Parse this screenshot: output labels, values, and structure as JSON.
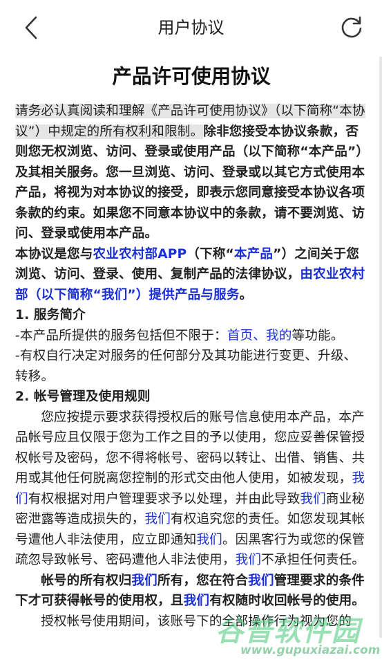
{
  "header": {
    "title": "用户协议"
  },
  "document": {
    "title": "产品许可使用协议",
    "p1": {
      "hl1": "请务必认真阅读和理解《产品许可使用协议》（以下简称",
      "hl2": "“本协议”）中规定的所有权利和限制。",
      "bold": "除非您接受本协议条款，否则您无权浏览、访问、登录或使用产品（以下简称“本产品”）及其相关服务。您一旦浏览、访问、登录或以其它方式使用本产品，将视为对本协议的接受，即表示您同意接受本协议各项条款的约束。如果您不同意本协议中的条款，请不要浏览、访问、登录或使用本产品。"
    },
    "p2": {
      "t1": "本协议是您与",
      "link1": "农业农村部APP",
      "t2": "（下称“",
      "link2": "本产品",
      "t3": "”）之间关于您浏览、访问、登录、使用、复制产品的法律协议，",
      "link3": "由农业农村部（以下简称“我们”）提供产品与服务",
      "t4": "。"
    },
    "s1": {
      "heading": "1. 服务简介",
      "l1_a": "-本产品所提供的服务包括但不限于：",
      "l1_link": "首页、我的",
      "l1_b": "等功能。",
      "l2": "-有权自行决定对服务的任何部分及其功能进行变更、升级、转移。"
    },
    "s2": {
      "heading": "2. 帐号管理及使用规则",
      "p_a": "您应按提示要求获得授权后的账号信息使用本产品，本产品帐号应且仅限于您为工作之目的予以使用，您应妥善保管授权帐号及密码，您不得将帐号、密码以转让、出借、销售、共用或其他任何脱离您控制的形式交由他人使用，如被发现，",
      "we": "我们",
      "p_b": "有权根据对用户管理要求予以处理，并由此导致",
      "p_c": "商业秘密泄露等造成损失的，",
      "p_d": "有权追究您的责任。如您发现其帐号遭他人非法使用，应立即通知",
      "p_e": "。因黑客行为或您的保管疏忽导致帐号、密码遭他人非法使用，",
      "p_f": "不承担任何责任。",
      "b_a": "帐号的所有权归",
      "b_b": "所有，您在符合",
      "b_c": "管理要求的条件下才可获得帐号的使用权，且",
      "b_d": "有权随时收回帐号",
      "b_e": "的使用。",
      "last": "授权帐号使用期间，该账号下的全部操作行为视为您的"
    }
  },
  "watermark": {
    "text": "谷普软件园",
    "url": "www.gupuxiazai.com"
  },
  "colors": {
    "link": "#1a2fd6",
    "highlight": "#e5e5e5"
  }
}
